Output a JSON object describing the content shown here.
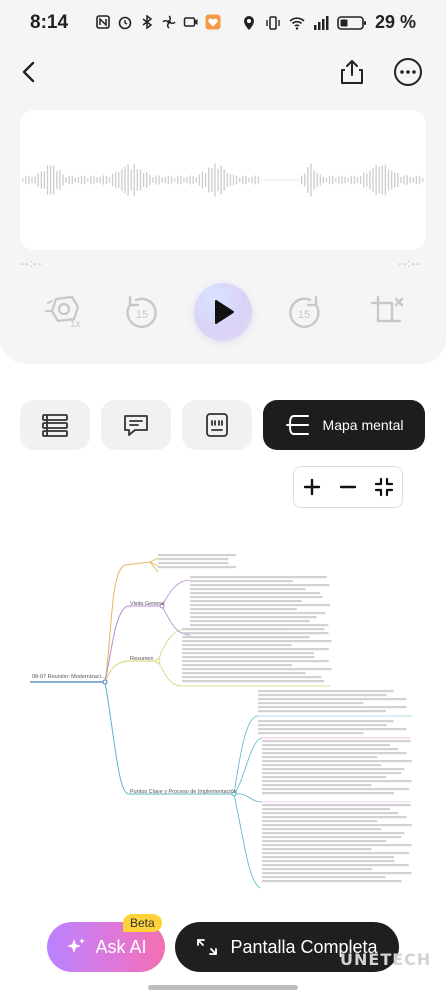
{
  "status_bar": {
    "time": "8:14",
    "battery_percent": "29 %",
    "left_icons": [
      "nfc-icon",
      "alarm-icon",
      "bluetooth-icon",
      "fan-icon",
      "camera-icon",
      "heart-app-icon"
    ],
    "right_icons": [
      "location-icon",
      "vibrate-icon",
      "wifi-icon",
      "signal-icon",
      "battery-icon"
    ]
  },
  "player": {
    "elapsed": "--:--",
    "remaining": "--:--",
    "speed_badge": "1x",
    "rewind_seconds": "15",
    "forward_seconds": "15"
  },
  "tabs": {
    "active_label": "Mapa mental",
    "items": [
      "list-tab",
      "chat-tab",
      "quote-tab",
      "mindmap-tab"
    ]
  },
  "mindmap": {
    "root": "08-07 Reunión: Modernizaci...",
    "branches": [
      "Visita General",
      "Resumen",
      "Puntos Clave y Proceso de Implementación"
    ]
  },
  "bottom": {
    "ask_label": "Ask AI",
    "beta_label": "Beta",
    "full_label": "Pantalla Completa"
  },
  "watermark": "UNETECH",
  "colors": {
    "accent_dark": "#1d1d1d",
    "ask_gradient_start": "#b982ff",
    "ask_gradient_end": "#f46fb0",
    "beta_yellow": "#ffd23a",
    "branch_orange": "#e8b35a",
    "branch_purple": "#b78ad6",
    "branch_teal": "#58b6c9",
    "branch_yellow": "#d6d36b"
  }
}
